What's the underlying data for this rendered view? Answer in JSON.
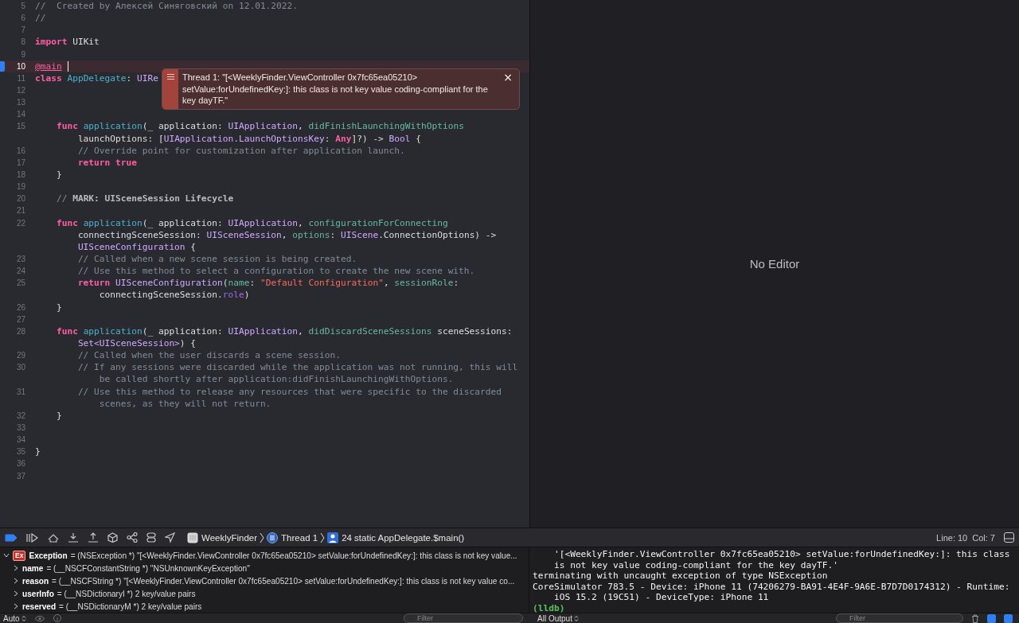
{
  "editor": {
    "lines": [
      {
        "number": "5",
        "highlighted": false,
        "rows": [
          {
            "segments": [
              {
                "kind": "comment",
                "text": "//  Created by Алексей Синяговский on 12.01.2022."
              }
            ]
          }
        ]
      },
      {
        "number": "6",
        "highlighted": false,
        "rows": [
          {
            "segments": [
              {
                "kind": "comment",
                "text": "//"
              }
            ]
          }
        ]
      },
      {
        "number": "7",
        "highlighted": false
      },
      {
        "number": "8",
        "highlighted": false,
        "rows": [
          {
            "segments": [
              {
                "kind": "keyword",
                "text": "import"
              },
              {
                "kind": "plain",
                "text": " UIKit"
              }
            ]
          }
        ]
      },
      {
        "number": "9",
        "highlighted": false
      },
      {
        "number": "10",
        "highlighted": true,
        "rows": [
          {
            "segments": [
              {
                "kind": "attribute",
                "text": "@main"
              }
            ]
          }
        ]
      },
      {
        "number": "11",
        "highlighted": false,
        "rows": [
          {
            "segments": [
              {
                "kind": "keyword",
                "text": "class "
              },
              {
                "kind": "decl",
                "text": "AppDelegate"
              },
              {
                "kind": "plain",
                "text": ": "
              },
              {
                "kind": "type",
                "text": "UIRe"
              }
            ]
          }
        ]
      },
      {
        "number": "12",
        "highlighted": false
      },
      {
        "number": "13",
        "highlighted": false
      },
      {
        "number": "14",
        "highlighted": false
      },
      {
        "number": "15",
        "highlighted": false,
        "rows": [
          {
            "segments": [
              {
                "kind": "keyword",
                "text": "    func "
              },
              {
                "kind": "decl",
                "text": "application"
              },
              {
                "kind": "plain",
                "text": "(_ application: "
              },
              {
                "kind": "type",
                "text": "UIApplication"
              },
              {
                "kind": "plain",
                "text": ", "
              },
              {
                "kind": "param",
                "text": "didFinishLaunchingWithOptions"
              }
            ]
          },
          {
            "segments": [
              {
                "kind": "plain",
                "text": "        launchOptions: ["
              },
              {
                "kind": "type",
                "text": "UIApplication.LaunchOptionsKey"
              },
              {
                "kind": "plain",
                "text": ": "
              },
              {
                "kind": "keyword",
                "text": "Any"
              },
              {
                "kind": "plain",
                "text": "]?) -> "
              },
              {
                "kind": "type",
                "text": "Bool"
              },
              {
                "kind": "plain",
                "text": " {"
              }
            ]
          }
        ]
      },
      {
        "number": "16",
        "highlighted": false,
        "rows": [
          {
            "segments": [
              {
                "kind": "comment",
                "text": "        // Override point for customization after application launch."
              }
            ]
          }
        ]
      },
      {
        "number": "17",
        "highlighted": false,
        "rows": [
          {
            "segments": [
              {
                "kind": "keyword",
                "text": "        return "
              },
              {
                "kind": "keyword",
                "text": "true"
              }
            ]
          }
        ]
      },
      {
        "number": "18",
        "highlighted": false,
        "rows": [
          {
            "segments": [
              {
                "kind": "plain",
                "text": "    }"
              }
            ]
          }
        ]
      },
      {
        "number": "19",
        "highlighted": false
      },
      {
        "number": "20",
        "highlighted": false,
        "rows": [
          {
            "segments": [
              {
                "kind": "comment",
                "text": "    // "
              },
              {
                "kind": "mark",
                "text": "MARK: UISceneSession Lifecycle"
              }
            ]
          }
        ]
      },
      {
        "number": "21",
        "highlighted": false
      },
      {
        "number": "22",
        "highlighted": false,
        "rows": [
          {
            "segments": [
              {
                "kind": "keyword",
                "text": "    func "
              },
              {
                "kind": "decl",
                "text": "application"
              },
              {
                "kind": "plain",
                "text": "(_ application: "
              },
              {
                "kind": "type",
                "text": "UIApplication"
              },
              {
                "kind": "plain",
                "text": ", "
              },
              {
                "kind": "param",
                "text": "configurationForConnecting"
              }
            ]
          },
          {
            "segments": [
              {
                "kind": "plain",
                "text": "        connectingSceneSession: "
              },
              {
                "kind": "type",
                "text": "UISceneSession"
              },
              {
                "kind": "plain",
                "text": ", "
              },
              {
                "kind": "param",
                "text": "options"
              },
              {
                "kind": "plain",
                "text": ": "
              },
              {
                "kind": "type",
                "text": "UIScene"
              },
              {
                "kind": "plain",
                "text": ".ConnectionOptions) ->"
              }
            ]
          },
          {
            "segments": [
              {
                "kind": "type",
                "text": "        UISceneConfiguration"
              },
              {
                "kind": "plain",
                "text": " {"
              }
            ]
          }
        ]
      },
      {
        "number": "23",
        "highlighted": false,
        "rows": [
          {
            "segments": [
              {
                "kind": "comment",
                "text": "        // Called when a new scene session is being created."
              }
            ]
          }
        ]
      },
      {
        "number": "24",
        "highlighted": false,
        "rows": [
          {
            "segments": [
              {
                "kind": "comment",
                "text": "        // Use this method to select a configuration to create the new scene with."
              }
            ]
          }
        ]
      },
      {
        "number": "25",
        "highlighted": false,
        "rows": [
          {
            "segments": [
              {
                "kind": "keyword",
                "text": "        return "
              },
              {
                "kind": "type",
                "text": "UISceneConfiguration"
              },
              {
                "kind": "plain",
                "text": "("
              },
              {
                "kind": "param",
                "text": "name"
              },
              {
                "kind": "plain",
                "text": ": "
              },
              {
                "kind": "string",
                "text": "\"Default Configuration\""
              },
              {
                "kind": "plain",
                "text": ", "
              },
              {
                "kind": "param",
                "text": "sessionRole"
              },
              {
                "kind": "plain",
                "text": ":"
              }
            ]
          },
          {
            "segments": [
              {
                "kind": "plain",
                "text": "            connectingSceneSession."
              },
              {
                "kind": "property",
                "text": "role"
              },
              {
                "kind": "plain",
                "text": ")"
              }
            ]
          }
        ]
      },
      {
        "number": "26",
        "highlighted": false,
        "rows": [
          {
            "segments": [
              {
                "kind": "plain",
                "text": "    }"
              }
            ]
          }
        ]
      },
      {
        "number": "27",
        "highlighted": false
      },
      {
        "number": "28",
        "highlighted": false,
        "rows": [
          {
            "segments": [
              {
                "kind": "keyword",
                "text": "    func "
              },
              {
                "kind": "decl",
                "text": "application"
              },
              {
                "kind": "plain",
                "text": "(_ application: "
              },
              {
                "kind": "type",
                "text": "UIApplication"
              },
              {
                "kind": "plain",
                "text": ", "
              },
              {
                "kind": "param",
                "text": "didDiscardSceneSessions"
              },
              {
                "kind": "plain",
                "text": " sceneSessions:"
              }
            ]
          },
          {
            "segments": [
              {
                "kind": "type",
                "text": "        Set<UISceneSession>"
              },
              {
                "kind": "plain",
                "text": ") {"
              }
            ]
          }
        ]
      },
      {
        "number": "29",
        "highlighted": false,
        "rows": [
          {
            "segments": [
              {
                "kind": "comment",
                "text": "        // Called when the user discards a scene session."
              }
            ]
          }
        ]
      },
      {
        "number": "30",
        "highlighted": false,
        "rows": [
          {
            "segments": [
              {
                "kind": "comment",
                "text": "        // If any sessions were discarded while the application was not running, this will"
              }
            ]
          },
          {
            "segments": [
              {
                "kind": "comment",
                "text": "            be called shortly after application:didFinishLaunchingWithOptions."
              }
            ]
          }
        ]
      },
      {
        "number": "31",
        "highlighted": false,
        "rows": [
          {
            "segments": [
              {
                "kind": "comment",
                "text": "        // Use this method to release any resources that were specific to the discarded"
              }
            ]
          },
          {
            "segments": [
              {
                "kind": "comment",
                "text": "            scenes, as they will not return."
              }
            ]
          }
        ]
      },
      {
        "number": "32",
        "highlighted": false,
        "rows": [
          {
            "segments": [
              {
                "kind": "plain",
                "text": "    }"
              }
            ]
          }
        ]
      },
      {
        "number": "33",
        "highlighted": false
      },
      {
        "number": "34",
        "highlighted": false
      },
      {
        "number": "35",
        "highlighted": false,
        "rows": [
          {
            "segments": [
              {
                "kind": "plain",
                "text": "}"
              }
            ]
          }
        ]
      },
      {
        "number": "36",
        "highlighted": false
      },
      {
        "number": "37",
        "highlighted": false
      }
    ],
    "error_popover": {
      "message": "Thread 1: \"[<WeeklyFinder.ViewController 0x7fc65ea05210> setValue:forUndefinedKey:]: this class is not key value coding-compliant for the key dayTF.\"",
      "close": "×"
    }
  },
  "secondary_editor": {
    "label": "No Editor"
  },
  "debug_bar": {
    "breakpoints_active": true,
    "breadcrumb": [
      {
        "kind": "app",
        "label": "WeeklyFinder"
      },
      {
        "kind": "thread",
        "label": "Thread 1"
      },
      {
        "kind": "frame",
        "label": "24 static AppDelegate.$main()"
      }
    ],
    "line": "Line: 10",
    "column": "Col: 7"
  },
  "variables": [
    {
      "badge": "Ex",
      "name": "Exception",
      "value": "= (NSException *) \"[<WeeklyFinder.ViewController 0x7fc65ea05210> setValue:forUndefinedKey:]: this class is not key value...",
      "expanded": true,
      "children": [
        {
          "name": "name",
          "value": "= (__NSCFConstantString *) \"NSUnknownKeyException\"",
          "expanded": false
        },
        {
          "name": "reason",
          "value": "= (__NSCFString *) \"[<WeeklyFinder.ViewController 0x7fc65ea05210> setValue:forUndefinedKey:]: this class is not key value co...",
          "expanded": false
        },
        {
          "name": "userInfo",
          "value": "= (__NSDictionaryI *) 2 key/value pairs",
          "expanded": false
        },
        {
          "name": "reserved",
          "value": "= (__NSDictionaryM *) 2 key/value pairs",
          "expanded": false
        }
      ]
    }
  ],
  "console": [
    {
      "kind": "output",
      "text": "    '[<WeeklyFinder.ViewController 0x7fc65ea05210> setValue:forUndefinedKey:]: this class"
    },
    {
      "kind": "output",
      "text": "    is not key value coding-compliant for the key dayTF.'"
    },
    {
      "kind": "output",
      "text": "terminating with uncaught exception of type NSException"
    },
    {
      "kind": "output",
      "text": "CoreSimulator 783.5 - Device: iPhone 11 (74206279-BA91-4E4F-9A6E-B7D7D0174312) - Runtime:"
    },
    {
      "kind": "output",
      "text": "    iOS 15.2 (19C51) - DeviceType: iPhone 11"
    },
    {
      "kind": "prompt",
      "text": "(lldb)"
    }
  ],
  "variables_footer": {
    "scope": "Auto",
    "filter_placeholder": "Filter"
  },
  "console_footer": {
    "output": "All Output",
    "filter_placeholder": "Filter",
    "variables_view_on": true,
    "console_view_on": true
  }
}
